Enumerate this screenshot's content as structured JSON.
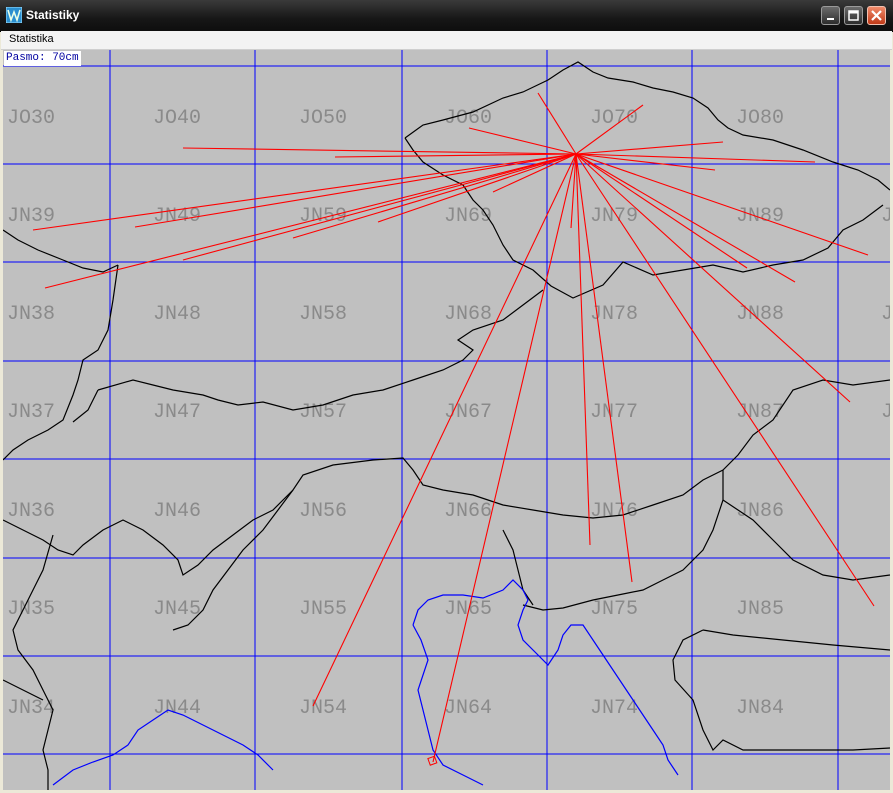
{
  "window": {
    "title": "Statistiky",
    "icon": "app-map-icon",
    "buttons": [
      "minimize-icon",
      "maximize-icon",
      "close-icon"
    ]
  },
  "menu": {
    "items": [
      {
        "label": "Statistika"
      }
    ]
  },
  "map": {
    "band_label": "Pasmo: 70cm",
    "grid_locators": [
      [
        "JO30",
        "JO40",
        "JO50",
        "JO60",
        "JO70",
        "JO80",
        ""
      ],
      [
        "JN39",
        "JN49",
        "JN59",
        "JN69",
        "JN79",
        "JN89",
        "J"
      ],
      [
        "JN38",
        "JN48",
        "JN58",
        "JN68",
        "JN78",
        "JN88",
        "J"
      ],
      [
        "JN37",
        "JN47",
        "JN57",
        "JN67",
        "JN77",
        "JN87",
        "J"
      ],
      [
        "JN36",
        "JN46",
        "JN56",
        "JN66",
        "JN76",
        "JN86",
        ""
      ],
      [
        "JN35",
        "JN45",
        "JN55",
        "JN65",
        "JN75",
        "JN85",
        ""
      ],
      [
        "JN34",
        "JN44",
        "JN54",
        "JN64",
        "JN74",
        "JN84",
        ""
      ]
    ],
    "colors": {
      "background": "#c0c0c0",
      "grid": "#0000ff",
      "borders": "#000000",
      "coastline": "#0000ff",
      "qso_lines": "#ff0000",
      "locator_text": "#8a8a8a"
    }
  }
}
